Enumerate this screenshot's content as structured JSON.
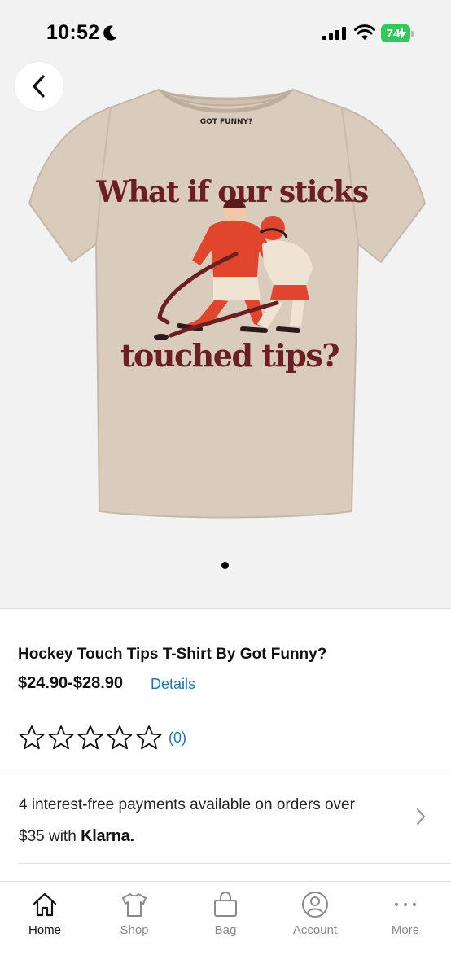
{
  "status_bar": {
    "time": "10:52",
    "battery": "74"
  },
  "product": {
    "title": "Hockey Touch Tips T-Shirt By Got Funny?",
    "price": "$24.90-$28.90",
    "details_label": "Details",
    "rating": 0,
    "rating_max": 5,
    "rating_count": "(0)",
    "shirt_print": {
      "top_text": "What if our sticks",
      "bottom_text": "touched tips?",
      "collar_text": "GOT FUNNY?"
    }
  },
  "carousel": {
    "current_index": 1,
    "total": 1
  },
  "payments": {
    "text_line1": "4 interest-free payments available on orders over",
    "text_line2": "$35 with",
    "provider": "Klarna."
  },
  "tab_bar": {
    "active": "Home",
    "tabs": [
      {
        "label": "Home",
        "icon": "home-icon"
      },
      {
        "label": "Shop",
        "icon": "tshirt-icon"
      },
      {
        "label": "Bag",
        "icon": "bag-icon"
      },
      {
        "label": "Account",
        "icon": "account-icon"
      },
      {
        "label": "More",
        "icon": "more-icon"
      }
    ]
  },
  "colors": {
    "link": "#1a75bb",
    "battery": "#34c759",
    "shirt": "#d9ccbd",
    "print_text": "#6b1f20",
    "jersey_red": "#e0452d"
  }
}
